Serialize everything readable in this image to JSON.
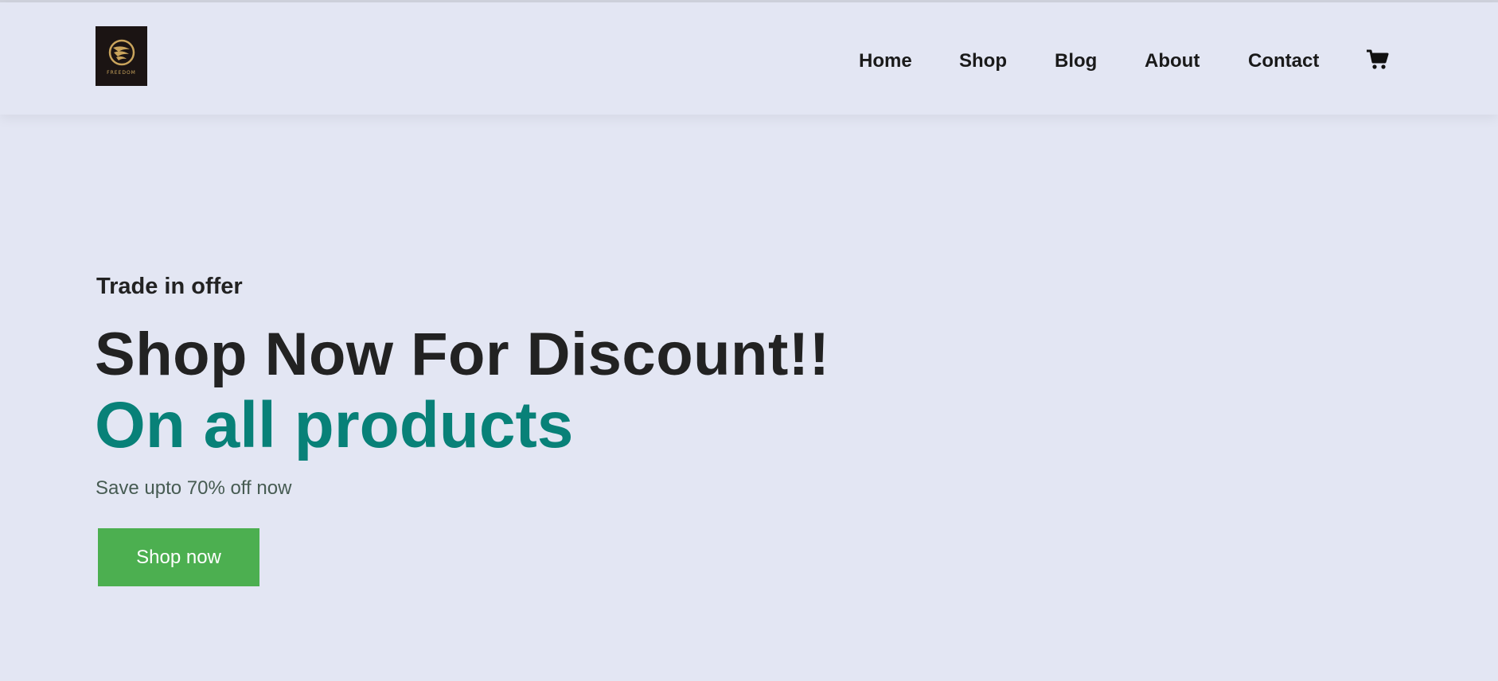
{
  "brand": {
    "logo_text": "FREEDOM",
    "logo_bg": "#1b1413",
    "logo_gold": "#c9a45c"
  },
  "nav": {
    "items": [
      {
        "label": "Home"
      },
      {
        "label": "Shop"
      },
      {
        "label": "Blog"
      },
      {
        "label": "About"
      },
      {
        "label": "Contact"
      }
    ],
    "cart_icon": "shopping-cart-icon"
  },
  "hero": {
    "kicker": "Trade in offer",
    "headline": "Shop Now For Discount!!",
    "subheadline": "On all products",
    "description": "Save upto 70% off now",
    "cta_label": "Shop now"
  },
  "colors": {
    "background": "#e3e6f3",
    "accent": "#088178",
    "button": "#4caf50",
    "text_dark": "#222222"
  }
}
